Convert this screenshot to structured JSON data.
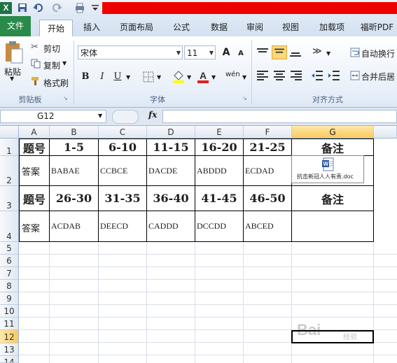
{
  "app": {
    "logo_letter": "X"
  },
  "tabs": {
    "file": "文件",
    "home": "开始",
    "insert": "插入",
    "page_layout": "页面布局",
    "formulas": "公式",
    "data": "数据",
    "review": "审阅",
    "view": "视图",
    "addins": "加载项",
    "foxit": "福昕PDF"
  },
  "clipboard": {
    "paste": "粘贴",
    "cut": "剪切",
    "copy": "复制",
    "format_painter": "格式刷",
    "group_label": "剪贴板"
  },
  "font": {
    "name": "宋体",
    "size": "11",
    "bold": "B",
    "italic": "I",
    "underline": "U",
    "group_label": "字体",
    "phonetic": "wén",
    "grow": "A",
    "shrink": "A"
  },
  "alignment": {
    "wrap_text": "自动换行",
    "merge_center": "合并后居",
    "group_label": "对齐方式"
  },
  "formula_bar": {
    "name_box": "G12",
    "fx": "fx",
    "content": ""
  },
  "columns": [
    "A",
    "B",
    "C",
    "D",
    "E",
    "F",
    "G"
  ],
  "rows": [
    "1",
    "2",
    "3",
    "4",
    "5",
    "6",
    "7",
    "8",
    "9",
    "10",
    "11",
    "12",
    "13",
    "14"
  ],
  "table": {
    "row1": [
      "题号",
      "1-5",
      "6-10",
      "11-15",
      "16-20",
      "21-25",
      "备注"
    ],
    "row2": [
      "答案",
      "BABAE",
      "CCBCE",
      "DACDE",
      "ABDDD",
      "ECDAD",
      ""
    ],
    "row3": [
      "题号",
      "26-30",
      "31-35",
      "36-40",
      "41-45",
      "46-50",
      "备注"
    ],
    "row4": [
      "答案",
      "ACDAB",
      "DEECD",
      "CADDD",
      "DCCDD",
      "ABCED",
      ""
    ]
  },
  "embedded_object": {
    "filename": "抗击新冠人人有责.doc",
    "icon": "word-doc-icon"
  },
  "watermark": {
    "text": "Bai",
    "sub": "经验"
  },
  "colors": {
    "accent_red": "#ee0000",
    "file_tab": "#2a8a4a",
    "selected_header": "#f8c960"
  }
}
